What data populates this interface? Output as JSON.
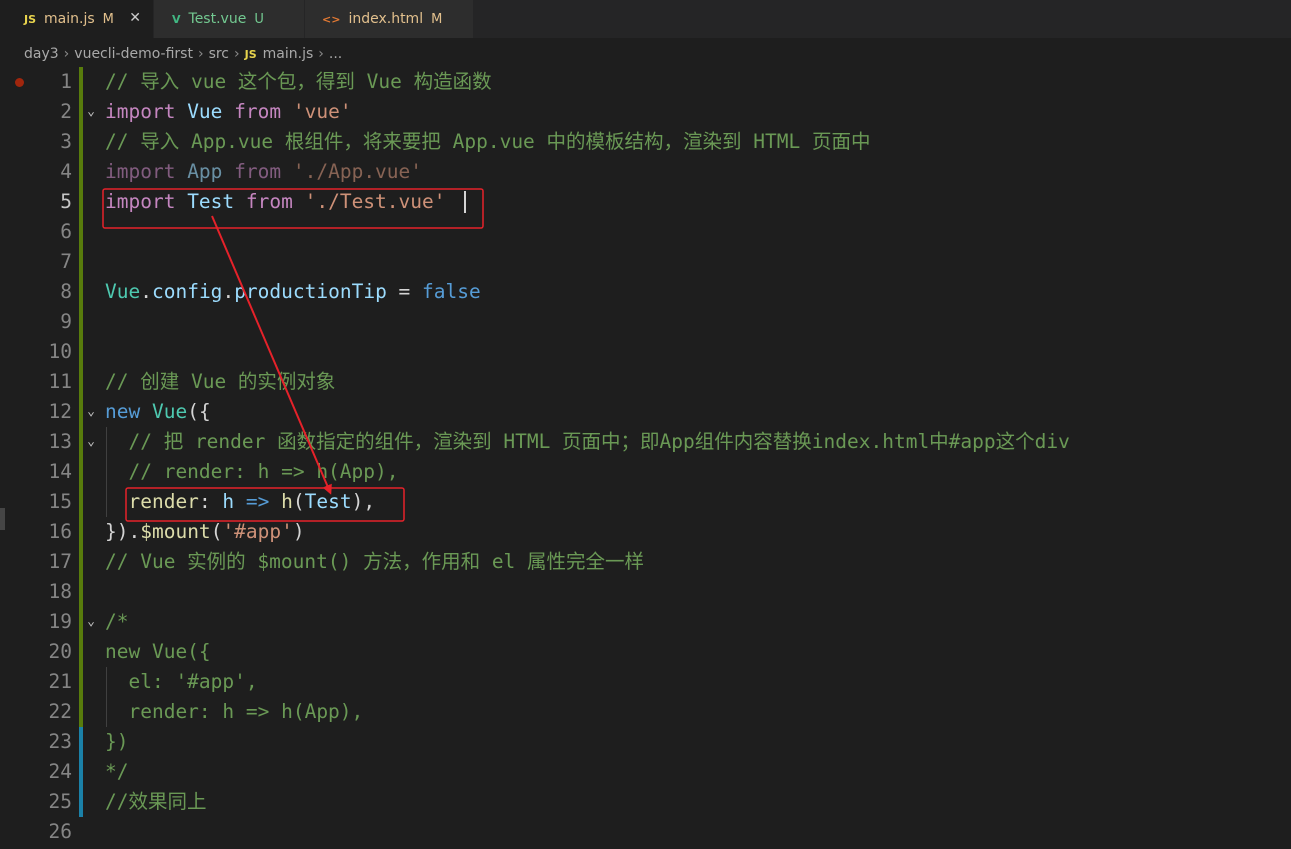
{
  "tabs": [
    {
      "icon": "JS",
      "label": "main.js",
      "status": "M",
      "active": true,
      "icon_color": "#e8d44d",
      "status_color": "#e2c08d"
    },
    {
      "icon": "V",
      "label": "Test.vue",
      "status": "U",
      "active": false,
      "icon_color": "#41b883",
      "status_color": "#73c991"
    },
    {
      "icon": "<>",
      "label": "index.html",
      "status": "M",
      "active": false,
      "icon_color": "#e37933",
      "status_color": "#e2c08d"
    }
  ],
  "breadcrumb": {
    "p1": "day3",
    "p2": "vuecli-demo-first",
    "p3": "src",
    "icon": "JS",
    "p4": "main.js",
    "p5": "..."
  },
  "lines": [
    {
      "n": "1",
      "parts": [
        {
          "t": "// 导入 vue 这个包，得到 Vue 构造函数",
          "c": "cm"
        }
      ]
    },
    {
      "n": "2",
      "parts": [
        {
          "t": "import ",
          "c": "kw"
        },
        {
          "t": "Vue",
          "c": "var"
        },
        {
          "t": " from ",
          "c": "kw"
        },
        {
          "t": "'vue'",
          "c": "st"
        }
      ]
    },
    {
      "n": "3",
      "parts": [
        {
          "t": "// 导入 App.vue 根组件，将来要把 App.vue 中的模板结构，渲染到 HTML 页面中",
          "c": "cm"
        }
      ]
    },
    {
      "n": "4",
      "parts": [
        {
          "t": "import ",
          "c": "kw dim"
        },
        {
          "t": "App",
          "c": "var dim"
        },
        {
          "t": " from ",
          "c": "kw dim"
        },
        {
          "t": "'./App.vue'",
          "c": "st dim"
        }
      ]
    },
    {
      "n": "5",
      "parts": [
        {
          "t": "import ",
          "c": "kw"
        },
        {
          "t": "Test",
          "c": "var"
        },
        {
          "t": " from ",
          "c": "kw"
        },
        {
          "t": "'./Test.vue'",
          "c": "st"
        }
      ]
    },
    {
      "n": "6",
      "parts": []
    },
    {
      "n": "7",
      "parts": []
    },
    {
      "n": "8",
      "parts": [
        {
          "t": "Vue",
          "c": "cls"
        },
        {
          "t": ".",
          "c": "pl"
        },
        {
          "t": "config",
          "c": "var"
        },
        {
          "t": ".",
          "c": "pl"
        },
        {
          "t": "productionTip",
          "c": "var"
        },
        {
          "t": " = ",
          "c": "pl"
        },
        {
          "t": "false",
          "c": "bl"
        }
      ]
    },
    {
      "n": "9",
      "parts": []
    },
    {
      "n": "10",
      "parts": []
    },
    {
      "n": "11",
      "parts": [
        {
          "t": "// 创建 Vue 的实例对象",
          "c": "cm"
        }
      ]
    },
    {
      "n": "12",
      "parts": [
        {
          "t": "new ",
          "c": "bl"
        },
        {
          "t": "Vue",
          "c": "cls"
        },
        {
          "t": "({",
          "c": "pl"
        }
      ]
    },
    {
      "n": "13",
      "parts": [
        {
          "t": "  // 把 render 函数指定的组件，渲染到 HTML 页面中；即App组件内容替换index.html中#app这个div",
          "c": "cm"
        }
      ]
    },
    {
      "n": "14",
      "parts": [
        {
          "t": "  // render: h => h(App),",
          "c": "cm"
        }
      ]
    },
    {
      "n": "15",
      "parts": [
        {
          "t": "  ",
          "c": "pl"
        },
        {
          "t": "render",
          "c": "fn"
        },
        {
          "t": ": ",
          "c": "pl"
        },
        {
          "t": "h",
          "c": "var"
        },
        {
          "t": " => ",
          "c": "bl"
        },
        {
          "t": "h",
          "c": "fn"
        },
        {
          "t": "(",
          "c": "pl"
        },
        {
          "t": "Test",
          "c": "var"
        },
        {
          "t": "),",
          "c": "pl"
        }
      ]
    },
    {
      "n": "16",
      "parts": [
        {
          "t": "}).",
          "c": "pl"
        },
        {
          "t": "$mount",
          "c": "fn"
        },
        {
          "t": "(",
          "c": "pl"
        },
        {
          "t": "'#app'",
          "c": "st"
        },
        {
          "t": ")",
          "c": "pl"
        }
      ]
    },
    {
      "n": "17",
      "parts": [
        {
          "t": "// Vue 实例的 $mount() 方法，作用和 el 属性完全一样",
          "c": "cm"
        }
      ]
    },
    {
      "n": "18",
      "parts": []
    },
    {
      "n": "19",
      "parts": [
        {
          "t": "/*",
          "c": "cm"
        }
      ]
    },
    {
      "n": "20",
      "parts": [
        {
          "t": "new Vue({",
          "c": "cm"
        }
      ]
    },
    {
      "n": "21",
      "parts": [
        {
          "t": "  el: '#app',",
          "c": "cm"
        }
      ]
    },
    {
      "n": "22",
      "parts": [
        {
          "t": "  render: h => h(App),",
          "c": "cm"
        }
      ]
    },
    {
      "n": "23",
      "parts": [
        {
          "t": "})",
          "c": "cm"
        }
      ]
    },
    {
      "n": "24",
      "parts": [
        {
          "t": "*/",
          "c": "cm"
        }
      ]
    },
    {
      "n": "25",
      "parts": [
        {
          "t": "//效果同上",
          "c": "cm"
        }
      ]
    },
    {
      "n": "26",
      "parts": []
    }
  ],
  "gutter_colors": {
    "modified": "#1b81a8",
    "added": "#587c0c"
  },
  "annotation_color": "#e5222a"
}
